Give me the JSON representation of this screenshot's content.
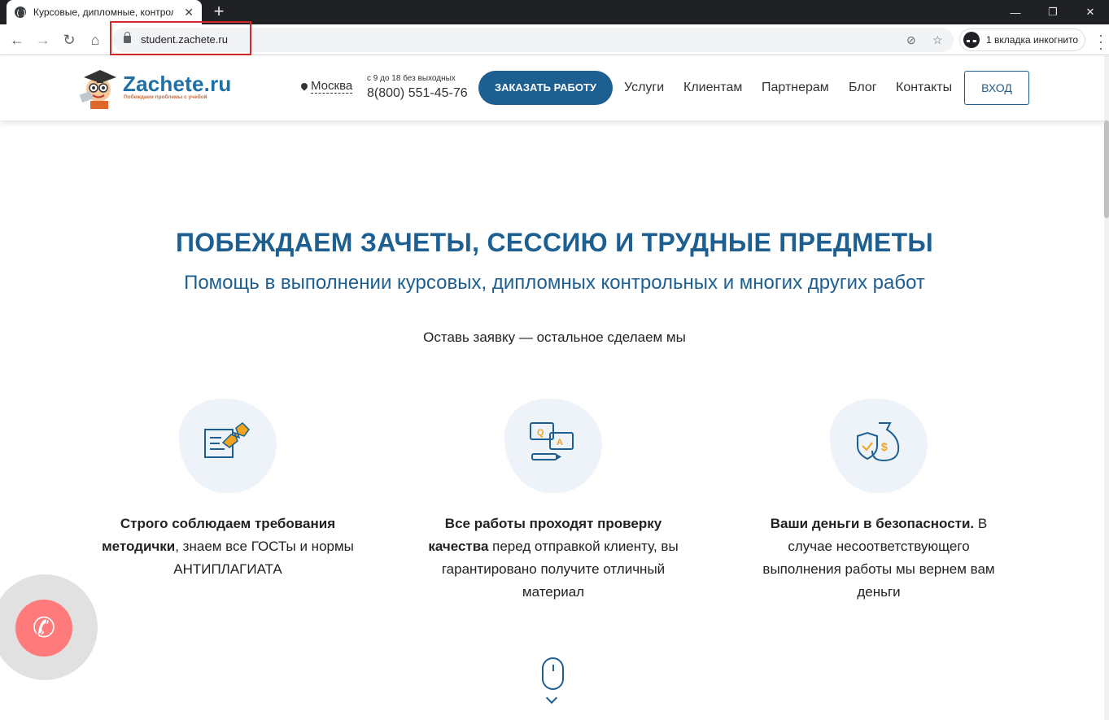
{
  "browser": {
    "tab_title": "Курсовые, дипломные, контрольные",
    "url": "student.zachete.ru",
    "incognito_label": "1 вкладка инкогнито"
  },
  "header": {
    "logo_text": "Zachete.ru",
    "logo_tagline": "Побеждаем проблемы с учебой",
    "city": "Москва",
    "hours": "с 9 до 18 без выходных",
    "phone": "8(800) 551-45-76",
    "order_button": "ЗАКАЗАТЬ РАБОТУ",
    "nav": [
      "Услуги",
      "Клиентам",
      "Партнерам",
      "Блог",
      "Контакты"
    ],
    "login_button": "ВХОД"
  },
  "hero": {
    "title": "ПОБЕЖДАЕМ ЗАЧЕТЫ, СЕССИЮ И ТРУДНЫЕ ПРЕДМЕТЫ",
    "subtitle": "Помощь в выполнении курсовых, дипломных контрольных и многих других работ",
    "cta": "Оставь заявку — остальное сделаем мы"
  },
  "features": [
    {
      "icon": "document-pin-icon",
      "bold": "Строго соблюдаем требования методички",
      "rest": ", знаем все ГОСТы и нормы АНТИПЛАГИАТА"
    },
    {
      "icon": "qa-chat-icon",
      "bold": "Все работы проходят проверку качества",
      "rest": " перед отправкой клиенту, вы гарантировано получите отличный материал"
    },
    {
      "icon": "money-shield-icon",
      "bold": "Ваши деньги в безопасности.",
      "rest": " В случае несоответствующего выполнения работы мы вернем вам деньги"
    }
  ],
  "colors": {
    "brand_blue": "#1e5f91",
    "accent_orange": "#f0a31f",
    "call_red": "#ff7a7a"
  }
}
